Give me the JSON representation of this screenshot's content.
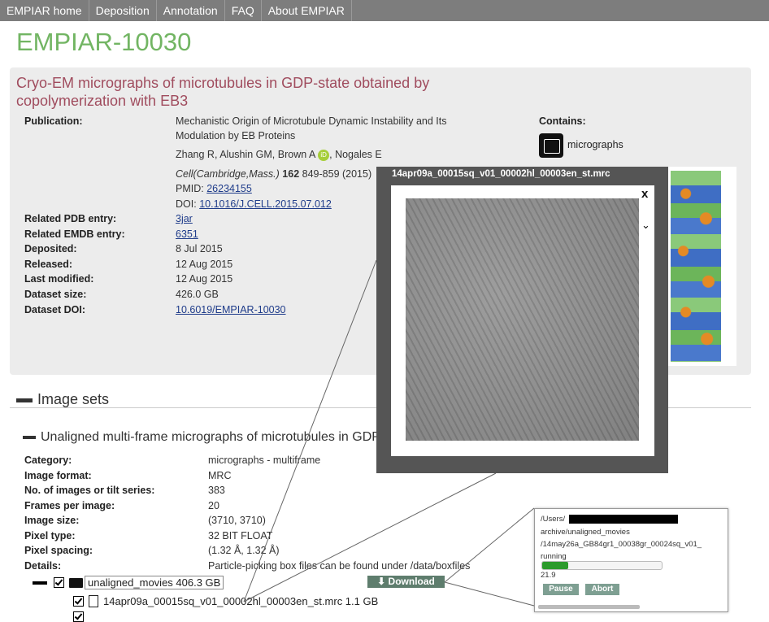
{
  "nav": [
    "EMPIAR home",
    "Deposition",
    "Annotation",
    "FAQ",
    "About EMPIAR"
  ],
  "page_title": "EMPIAR-10030",
  "entry": {
    "title": "Cryo-EM micrographs of microtubules in GDP-state obtained by copolymerization with EB3",
    "publication_label": "Publication:",
    "pub_title_line1": "Mechanistic Origin of Microtubule Dynamic Instability and Its",
    "pub_title_line2": "Modulation by EB Proteins",
    "authors_a": "Zhang R, Alushin GM, Brown A",
    "authors_b": "Nogales E",
    "orcid": "iD",
    "journal": "Cell(Cambridge,Mass.)",
    "volume": "162",
    "pages": "849-859 (2015)",
    "pmid_label": "PMID:",
    "pmid": "26234155",
    "doi_label": "DOI:",
    "doi": "10.1016/J.CELL.2015.07.012",
    "rows": [
      {
        "label": "Related PDB entry:",
        "value": "3jar",
        "link": true
      },
      {
        "label": "Related EMDB entry:",
        "value": "6351",
        "link": true
      },
      {
        "label": "Deposited:",
        "value": "8 Jul 2015",
        "link": false
      },
      {
        "label": "Released:",
        "value": "12 Aug 2015",
        "link": false
      },
      {
        "label": "Last modified:",
        "value": "12 Aug 2015",
        "link": false
      },
      {
        "label": "Dataset size:",
        "value": "426.0 GB",
        "link": false
      },
      {
        "label": "Dataset DOI:",
        "value": "10.6019/EMPIAR-10030",
        "link": true
      }
    ],
    "contains_label": "Contains:",
    "contains_value": "micrographs"
  },
  "image_sets_header": "Image sets",
  "imageset": {
    "title": "Unaligned multi-frame micrographs of microtubules in GDP-s",
    "rows": [
      {
        "label": "Category:",
        "value": "micrographs - multiframe"
      },
      {
        "label": "Image format:",
        "value": "MRC"
      },
      {
        "label": "No. of images or tilt series:",
        "value": "383"
      },
      {
        "label": "Frames per image:",
        "value": "20"
      },
      {
        "label": "Image size:",
        "value": "(3710, 3710)"
      },
      {
        "label": "Pixel type:",
        "value": "32 BIT FLOAT"
      },
      {
        "label": "Pixel spacing:",
        "value": "(1.32 Å, 1.32 Å)"
      },
      {
        "label": "Details:",
        "value": "Particle-picking box files can be found under /data/boxfiles"
      }
    ]
  },
  "tree": {
    "folder": "unaligned_movies 406.3 GB",
    "file1": "14apr09a_00015sq_v01_00002hl_00003en_st.mrc 1.1 GB",
    "download_label": "Download",
    "download_icon": "download-arrow-icon"
  },
  "overlay": {
    "title": "14apr09a_00015sq_v01_00002hl_00003en_st.mrc",
    "close": "x",
    "chevron": "⌄"
  },
  "progress": {
    "path1": "/Users/",
    "path2": "archive/unaligned_movies",
    "path3": "/14may26a_GB84gr1_00038gr_00024sq_v01_",
    "status": "running",
    "value": 21.9,
    "value_text": "21.9",
    "pause": "Pause",
    "abort": "Abort"
  },
  "colors": {
    "accent_green": "#72b563",
    "title_red": "#a04c5e",
    "link_blue": "#1f3c8a",
    "progress_green": "#2c9b2c"
  }
}
